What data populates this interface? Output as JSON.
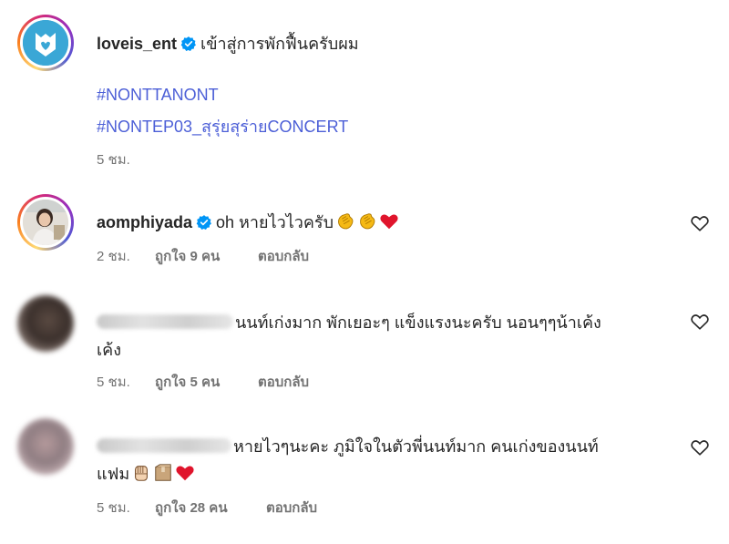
{
  "post": {
    "username": "loveis_ent",
    "caption": "เข้าสู่การพักฟื้นครับผม",
    "hashtags": [
      "#NONTTANONT",
      "#NONTEP03_สุรุ่ยสุร่ายCONCERT"
    ],
    "time": "5 ชม."
  },
  "comments": [
    {
      "username": "aomphiyada",
      "text": "oh หายไวไวครับ",
      "time": "2 ชม.",
      "likes": "ถูกใจ 9 คน",
      "reply": "ตอบกลับ"
    },
    {
      "username": "",
      "text_line1": "นนท์เก่งมาก พักเยอะๆ แข็งแรงนะครับ นอนๆๆน้าเค้ง",
      "text_line2": "เค้ง",
      "time": "5 ชม.",
      "likes": "ถูกใจ 5 คน",
      "reply": "ตอบกลับ"
    },
    {
      "username": "",
      "text_line1": "หายไวๆนะคะ ภูมิใจในตัวพี่นนท์มาก คนเก่งของนนท์",
      "text_line2": "แฟม",
      "time": "5 ชม.",
      "likes": "ถูกใจ 28 คน",
      "reply": "ตอบกลับ"
    }
  ],
  "icons": {
    "verified": "verified-badge-icon",
    "heart": "heart-outline-icon",
    "clap": "clapping-hands-emoji",
    "red_heart": "red-heart-emoji",
    "hand": "raised-fist-emoji",
    "box": "package-emoji"
  },
  "colors": {
    "hashtag": "#4c5fd7",
    "verified": "#0095f6",
    "meta": "#737373",
    "text": "#262626"
  }
}
